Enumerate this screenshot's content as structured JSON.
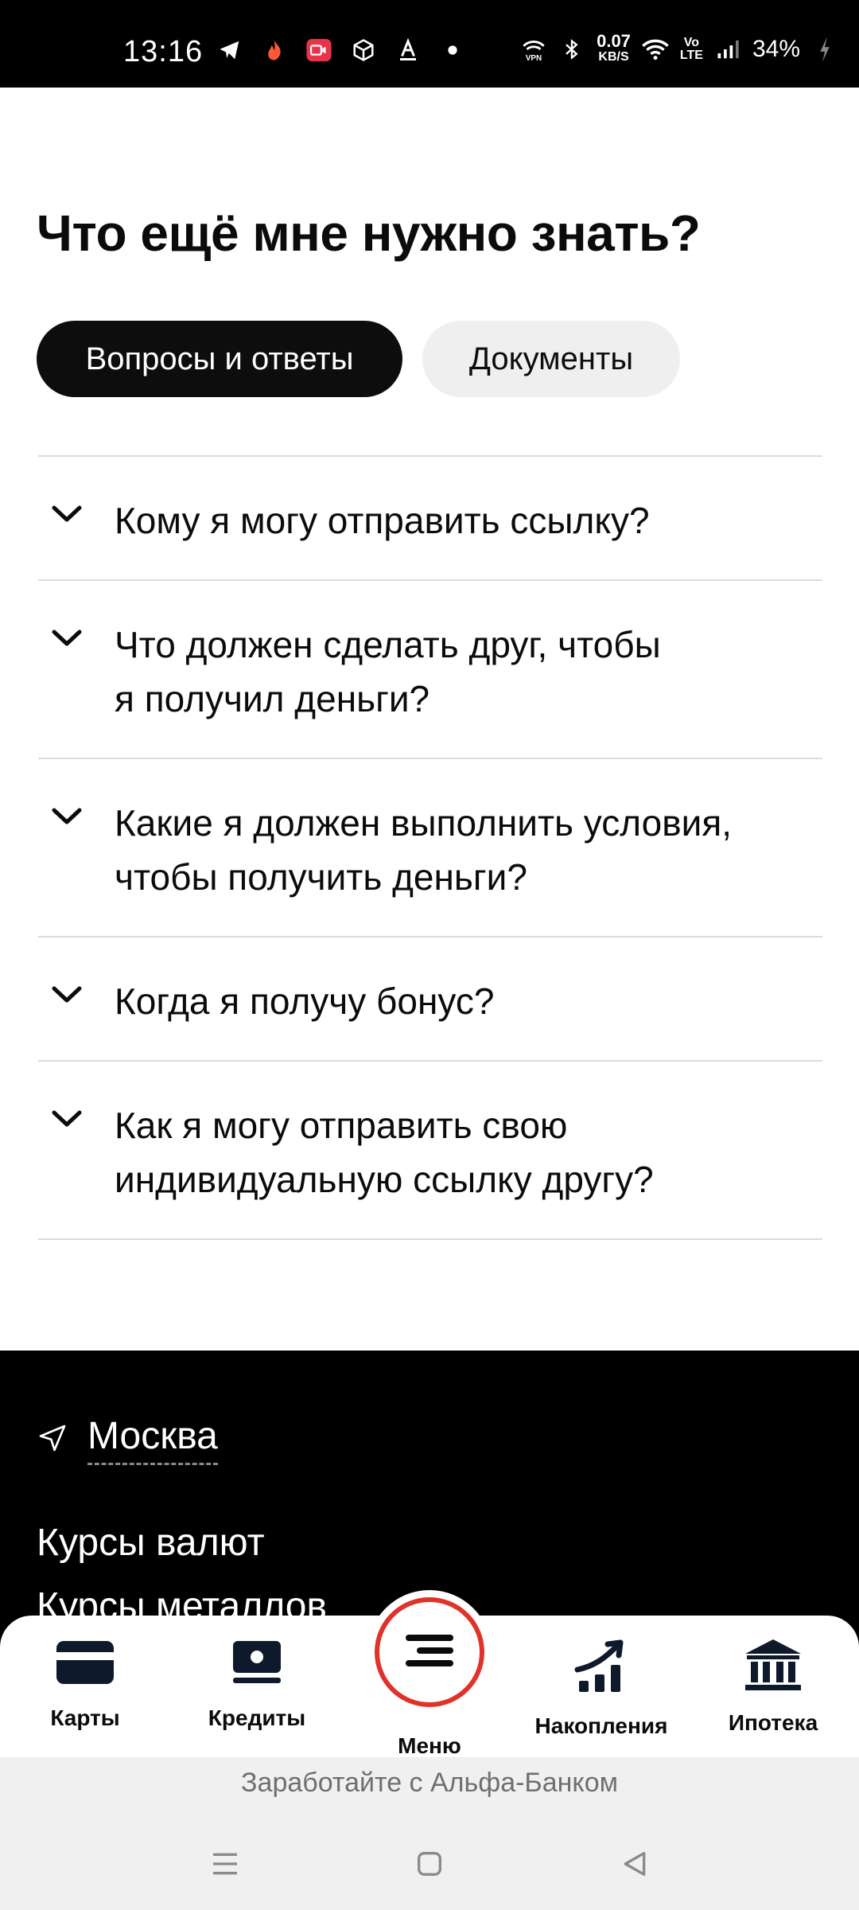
{
  "status_bar": {
    "time": "13:16",
    "net_speed_value": "0.07",
    "net_speed_unit": "KB/S",
    "volte": "Vo\nLTE",
    "battery": "34%",
    "icons_left": [
      "telegram-icon",
      "flame-icon",
      "video-icon",
      "package-icon",
      "text-a-icon",
      "dot-icon"
    ],
    "icons_right": [
      "vpn-icon",
      "bluetooth-icon",
      "wifi-icon",
      "signal-icon",
      "charging-icon"
    ]
  },
  "section": {
    "title": "Что ещё мне нужно знать?"
  },
  "tabs": [
    {
      "label": "Вопросы и ответы",
      "active": true
    },
    {
      "label": "Документы",
      "active": false
    }
  ],
  "faq": [
    {
      "question": "Кому я могу отправить ссылку?"
    },
    {
      "question": "Что должен сделать друг, чтобы\nя получил деньги?"
    },
    {
      "question": "Какие я должен выполнить условия,\nчтобы получить деньги?"
    },
    {
      "question": "Когда я получу бонус?"
    },
    {
      "question": "Как я могу отправить свою\nиндивидуальную ссылку другу?"
    }
  ],
  "footer": {
    "city": "Москва",
    "links": [
      "Курсы валют",
      "Курсы металлов"
    ]
  },
  "bottom_nav": {
    "items": [
      {
        "label": "Карты",
        "icon": "card-icon"
      },
      {
        "label": "Кредиты",
        "icon": "credit-icon"
      },
      {
        "label": "Меню",
        "icon": "menu-icon"
      },
      {
        "label": "Накопления",
        "icon": "growth-chart-icon"
      },
      {
        "label": "Ипотека",
        "icon": "bank-building-icon"
      }
    ]
  },
  "promo": {
    "text": "Заработайте с Альфа-Банком"
  },
  "colors": {
    "accent_red": "#e0322a",
    "dark_navy": "#0e1a2b",
    "tab_active_bg": "#0d0d0d",
    "tab_inactive_bg": "#efefef"
  }
}
